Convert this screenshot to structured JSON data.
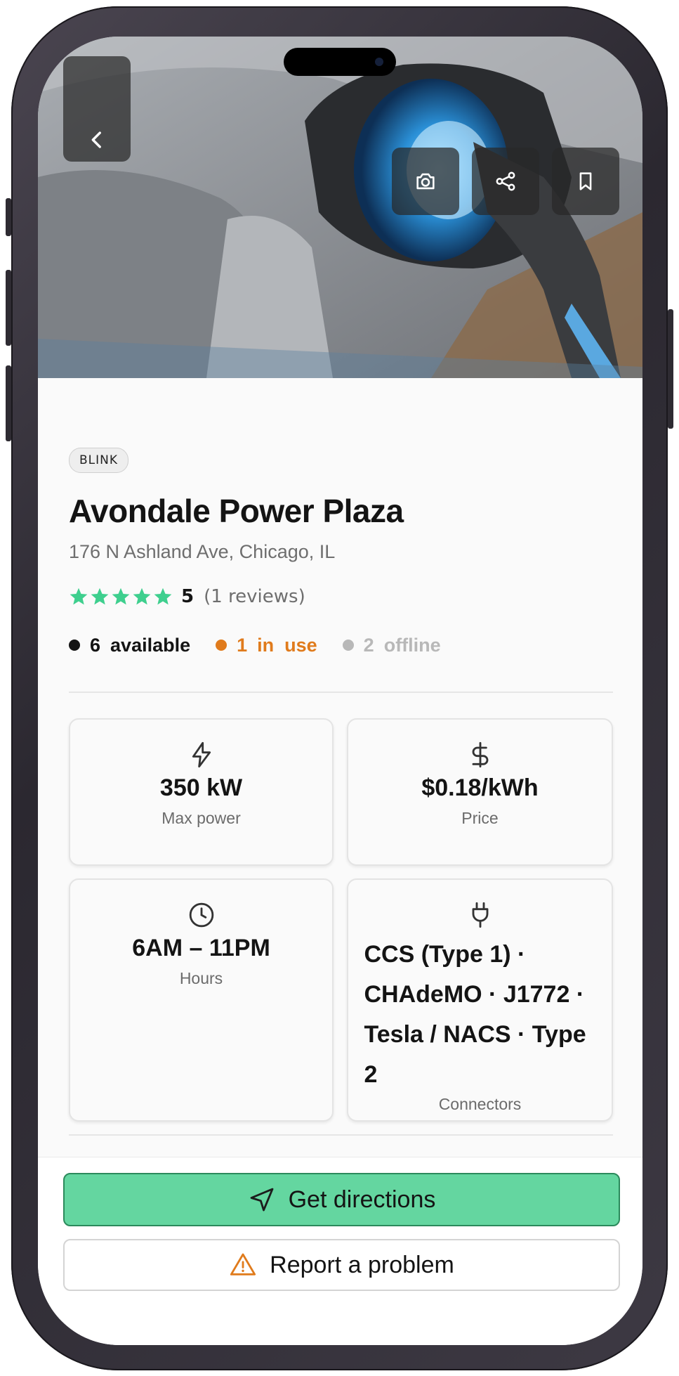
{
  "header": {
    "back_icon": "chevron-left-icon",
    "actions": [
      "camera-icon",
      "share-icon",
      "bookmark-icon"
    ]
  },
  "station": {
    "network": "BLINK",
    "name": "Avondale Power Plaza",
    "address": "176 N Ashland Ave, Chicago, IL",
    "rating": "5",
    "reviews": "(1 reviews)",
    "stars": 5
  },
  "status": {
    "available_count": "6",
    "available_label": "available",
    "in_use_count": "1",
    "in_use_label": "in  use",
    "offline_count": "2",
    "offline_label": "offline"
  },
  "cards": {
    "power": {
      "icon": "lightning-icon",
      "value": "350 kW",
      "label": "Max power"
    },
    "price": {
      "icon": "dollar-icon",
      "value": "$0.18/kWh",
      "label": "Price"
    },
    "hours": {
      "icon": "clock-icon",
      "value": "6AM – 11PM",
      "label": "Hours"
    },
    "connectors": {
      "icon": "plug-icon",
      "value": "CCS (Type 1) · CHAdeMO · J1772 · Tesla / NACS · Type 2",
      "label": "Connectors"
    }
  },
  "actions": {
    "directions_label": "Get directions",
    "report_label": "Report a problem"
  },
  "colors": {
    "accent_green": "#64d6a0",
    "star_green": "#3ecf8e",
    "in_use_orange": "#e07b1c",
    "offline_gray": "#b8b8b8",
    "warning_orange": "#e07b1c"
  }
}
